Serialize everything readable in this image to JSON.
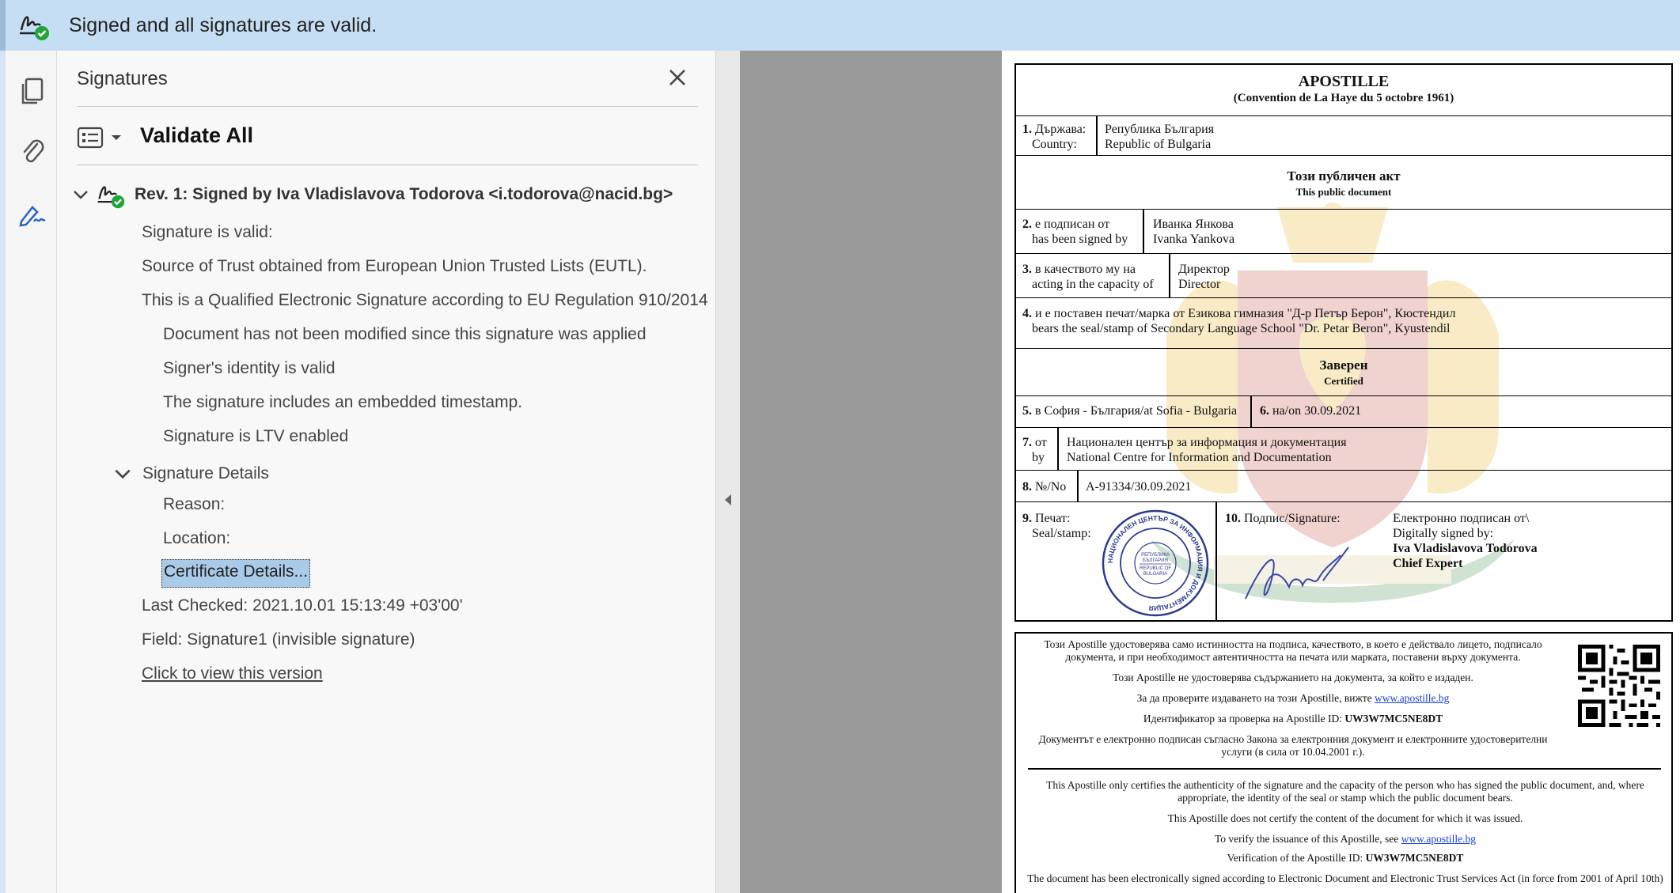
{
  "message_bar": {
    "text": "Signed and all signatures are valid.",
    "icon": "signature-valid-icon"
  },
  "rail": {
    "items": [
      {
        "name": "pages-icon"
      },
      {
        "name": "attachments-icon"
      },
      {
        "name": "signatures-icon",
        "active": true
      }
    ]
  },
  "panel": {
    "title": "Signatures",
    "validate_all": "Validate All",
    "revision": {
      "label": "Rev. 1: Signed by Iva Vladislavova Todorova <i.todorova@nacid.bg>",
      "status_lines": [
        "Signature is valid:",
        "Source of Trust obtained from European Union Trusted Lists (EUTL).",
        "This is a Qualified Electronic Signature according to EU Regulation 910/2014"
      ],
      "checks": [
        "Document has not been modified since this signature was applied",
        "Signer's identity is valid",
        "The signature includes an embedded timestamp.",
        "Signature is LTV enabled"
      ],
      "details_label": "Signature Details",
      "reason": "Reason:",
      "location": "Location:",
      "certificate_details": "Certificate Details...",
      "last_checked": "Last Checked: 2021.10.01 15:13:49 +03'00'",
      "field": "Field: Signature1 (invisible signature)",
      "view_version": "Click to view this version"
    }
  },
  "document": {
    "title": "APOSTILLE",
    "subtitle": "(Convention de La Haye du 5 octobre 1961)",
    "row1": {
      "num": "1.",
      "label_bg": "Държава:",
      "label_en": "Country:",
      "value_bg": "Република България",
      "value_en": "Republic of Bulgaria"
    },
    "public_doc_bg": "Този публичен акт",
    "public_doc_en": "This public document",
    "row2": {
      "num": "2.",
      "label_bg": "е подписан от",
      "label_en": "has been signed by",
      "value_bg": "Иванка Янкова",
      "value_en": "Ivanka Yankova"
    },
    "row3": {
      "num": "3.",
      "label_bg": "в качеството му на",
      "label_en": "acting in the capacity of",
      "value_bg": "Директор",
      "value_en": "Director"
    },
    "row4": {
      "num": "4.",
      "bg": "и е поставен печат/марка от Езикова гимназия \"Д-р Петър Берон\", Кюстендил",
      "en": "bears the seal/stamp of Secondary Language School \"Dr. Petar Beron\", Kyustendil"
    },
    "certified_bg": "Заверен",
    "certified_en": "Certified",
    "row5": {
      "num": "5.",
      "text": "в София - България/at Sofia - Bulgaria",
      "num6": "6.",
      "text6": "на/on 30.09.2021"
    },
    "row7": {
      "num": "7.",
      "label_bg": "от",
      "label_en": "by",
      "value_bg": "Национален център за информация и документация",
      "value_en": "National Centre for Information and Documentation"
    },
    "row8": {
      "num": "8.",
      "label": "№/No",
      "value": "А-91334/30.09.2021"
    },
    "row9": {
      "num": "9.",
      "label_bg": "Печат:",
      "label_en": "Seal/stamp:",
      "num10": "10.",
      "label10": "Подпис/Signature:",
      "esig_bg": "Електронно подписан от\\",
      "esig_en": "Digitally signed by:",
      "signer": "Iva Vladislavova Todorova",
      "signer_title": "Chief Expert"
    },
    "stamp": {
      "outer": "НАЦИОНАЛЕН ЦЕНТЪР ЗА ИНФОРМАЦИЯ И ДОКУМЕНТАЦИЯ",
      "inner_top": "РЕПУБЛИКА",
      "inner_top2": "БЪЛГАРИЯ",
      "inner_bottom": "REPUBLIC OF",
      "inner_bottom2": "BULGARIA"
    },
    "info": {
      "bg1": "Този Apostille удостоверява само истинността на подписа, качеството, в което е действало лицето, подписало документа, и при необходимост автентичността на печата или марката, поставени върху документа.",
      "bg2": "Този Apostille не удостоверява съдържанието на документа, за който е издаден.",
      "bg3_pre": "За да проверите издаването на този Apostille, вижте ",
      "link": "www.apostille.bg",
      "bg4_pre": "Идентификатор за проверка на Apostille ID: ",
      "apostille_id": "UW3W7MC5NE8DT",
      "bg5": "Документът е електронно подписан съгласно Закона за електронния документ и електронните удостоверителни услуги (в сила от 10.04.2001 г.).",
      "en1": "This Apostille only certifies the authenticity of the signature and the capacity of the person who has signed the public document, and, where appropriate, the identity of the seal or stamp which the public document bears.",
      "en2": "This Apostille does not certify the content of the document for which it was issued.",
      "en3_pre": "To verify the issuance of this Apostille, see ",
      "en4_pre": "Verification of the Apostille ID: ",
      "en5": "The document has been electronically signed according to Electronic Document and Electronic Trust Services Act (in force from 2001 of April 10th)"
    }
  }
}
